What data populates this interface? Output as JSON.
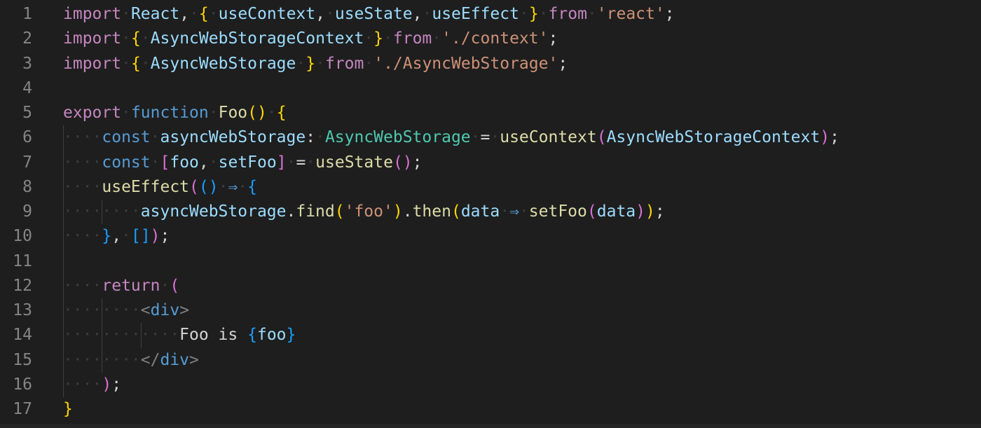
{
  "editor": {
    "language": "typescriptreact",
    "theme_bg": "#1e1e1e",
    "colors": {
      "keyword": "#c586c0",
      "storage": "#569cd6",
      "variable": "#9cdcfe",
      "function": "#dcdcaa",
      "string": "#ce9178",
      "type": "#4ec9b0",
      "bracket_level1": "#ffd700",
      "bracket_level2": "#da70d6",
      "bracket_level3": "#179fff",
      "line_number": "#858585"
    },
    "lines": [
      {
        "n": "1",
        "indent": 0,
        "tokens": [
          {
            "t": "import",
            "c": "kw"
          },
          {
            "t": " ",
            "c": "ws"
          },
          {
            "t": "React",
            "c": "var"
          },
          {
            "t": ",",
            "c": "pun"
          },
          {
            "t": " ",
            "c": "ws"
          },
          {
            "t": "{",
            "c": "b1"
          },
          {
            "t": " ",
            "c": "ws"
          },
          {
            "t": "useContext",
            "c": "var"
          },
          {
            "t": ",",
            "c": "pun"
          },
          {
            "t": " ",
            "c": "ws"
          },
          {
            "t": "useState",
            "c": "var"
          },
          {
            "t": ",",
            "c": "pun"
          },
          {
            "t": " ",
            "c": "ws"
          },
          {
            "t": "useEffect",
            "c": "var"
          },
          {
            "t": " ",
            "c": "ws"
          },
          {
            "t": "}",
            "c": "b1"
          },
          {
            "t": " ",
            "c": "ws"
          },
          {
            "t": "from",
            "c": "kw"
          },
          {
            "t": " ",
            "c": "ws"
          },
          {
            "t": "'react'",
            "c": "str"
          },
          {
            "t": ";",
            "c": "pun"
          }
        ]
      },
      {
        "n": "2",
        "indent": 0,
        "tokens": [
          {
            "t": "import",
            "c": "kw"
          },
          {
            "t": " ",
            "c": "ws"
          },
          {
            "t": "{",
            "c": "b1"
          },
          {
            "t": " ",
            "c": "ws"
          },
          {
            "t": "AsyncWebStorageContext",
            "c": "var"
          },
          {
            "t": " ",
            "c": "ws"
          },
          {
            "t": "}",
            "c": "b1"
          },
          {
            "t": " ",
            "c": "ws"
          },
          {
            "t": "from",
            "c": "kw"
          },
          {
            "t": " ",
            "c": "ws"
          },
          {
            "t": "'./context'",
            "c": "str"
          },
          {
            "t": ";",
            "c": "pun"
          }
        ]
      },
      {
        "n": "3",
        "indent": 0,
        "tokens": [
          {
            "t": "import",
            "c": "kw"
          },
          {
            "t": " ",
            "c": "ws"
          },
          {
            "t": "{",
            "c": "b1"
          },
          {
            "t": " ",
            "c": "ws"
          },
          {
            "t": "AsyncWebStorage",
            "c": "var"
          },
          {
            "t": " ",
            "c": "ws"
          },
          {
            "t": "}",
            "c": "b1"
          },
          {
            "t": " ",
            "c": "ws"
          },
          {
            "t": "from",
            "c": "kw"
          },
          {
            "t": " ",
            "c": "ws"
          },
          {
            "t": "'./AsyncWebStorage'",
            "c": "str"
          },
          {
            "t": ";",
            "c": "pun"
          }
        ]
      },
      {
        "n": "4",
        "indent": 0,
        "tokens": []
      },
      {
        "n": "5",
        "indent": 0,
        "tokens": [
          {
            "t": "export",
            "c": "kw"
          },
          {
            "t": " ",
            "c": "ws"
          },
          {
            "t": "function",
            "c": "sk"
          },
          {
            "t": " ",
            "c": "ws"
          },
          {
            "t": "Foo",
            "c": "fn"
          },
          {
            "t": "()",
            "c": "b1"
          },
          {
            "t": " ",
            "c": "ws"
          },
          {
            "t": "{",
            "c": "b1"
          }
        ]
      },
      {
        "n": "6",
        "indent": 1,
        "tokens": [
          {
            "t": "const",
            "c": "sk"
          },
          {
            "t": " ",
            "c": "ws"
          },
          {
            "t": "asyncWebStorage",
            "c": "var"
          },
          {
            "t": ":",
            "c": "pun"
          },
          {
            "t": " ",
            "c": "ws"
          },
          {
            "t": "AsyncWebStorage",
            "c": "ty"
          },
          {
            "t": " ",
            "c": "ws"
          },
          {
            "t": "=",
            "c": "op"
          },
          {
            "t": " ",
            "c": "ws"
          },
          {
            "t": "useContext",
            "c": "fn"
          },
          {
            "t": "(",
            "c": "b2"
          },
          {
            "t": "AsyncWebStorageContext",
            "c": "var"
          },
          {
            "t": ")",
            "c": "b2"
          },
          {
            "t": ";",
            "c": "pun"
          }
        ]
      },
      {
        "n": "7",
        "indent": 1,
        "tokens": [
          {
            "t": "const",
            "c": "sk"
          },
          {
            "t": " ",
            "c": "ws"
          },
          {
            "t": "[",
            "c": "b2"
          },
          {
            "t": "foo",
            "c": "var"
          },
          {
            "t": ",",
            "c": "pun"
          },
          {
            "t": " ",
            "c": "ws"
          },
          {
            "t": "setFoo",
            "c": "var"
          },
          {
            "t": "]",
            "c": "b2"
          },
          {
            "t": " ",
            "c": "ws"
          },
          {
            "t": "=",
            "c": "op"
          },
          {
            "t": " ",
            "c": "ws"
          },
          {
            "t": "useState",
            "c": "fn"
          },
          {
            "t": "()",
            "c": "b2"
          },
          {
            "t": ";",
            "c": "pun"
          }
        ]
      },
      {
        "n": "8",
        "indent": 1,
        "tokens": [
          {
            "t": "useEffect",
            "c": "fn"
          },
          {
            "t": "(",
            "c": "b2"
          },
          {
            "t": "()",
            "c": "b3"
          },
          {
            "t": " ",
            "c": "ws"
          },
          {
            "t": "⇒",
            "c": "ar"
          },
          {
            "t": " ",
            "c": "ws"
          },
          {
            "t": "{",
            "c": "b3"
          }
        ]
      },
      {
        "n": "9",
        "indent": 2,
        "tokens": [
          {
            "t": "asyncWebStorage",
            "c": "var"
          },
          {
            "t": ".",
            "c": "pun"
          },
          {
            "t": "find",
            "c": "fn"
          },
          {
            "t": "(",
            "c": "b1"
          },
          {
            "t": "'foo'",
            "c": "str"
          },
          {
            "t": ")",
            "c": "b1"
          },
          {
            "t": ".",
            "c": "pun"
          },
          {
            "t": "then",
            "c": "fn"
          },
          {
            "t": "(",
            "c": "b1"
          },
          {
            "t": "data",
            "c": "var"
          },
          {
            "t": " ",
            "c": "ws"
          },
          {
            "t": "⇒",
            "c": "ar"
          },
          {
            "t": " ",
            "c": "ws"
          },
          {
            "t": "setFoo",
            "c": "fn"
          },
          {
            "t": "(",
            "c": "b2"
          },
          {
            "t": "data",
            "c": "var"
          },
          {
            "t": ")",
            "c": "b2"
          },
          {
            "t": ")",
            "c": "b1"
          },
          {
            "t": ";",
            "c": "pun"
          }
        ]
      },
      {
        "n": "10",
        "indent": 1,
        "tokens": [
          {
            "t": "}",
            "c": "b3"
          },
          {
            "t": ",",
            "c": "pun"
          },
          {
            "t": " ",
            "c": "ws"
          },
          {
            "t": "[]",
            "c": "b3"
          },
          {
            "t": ")",
            "c": "b2"
          },
          {
            "t": ";",
            "c": "pun"
          }
        ]
      },
      {
        "n": "11",
        "indent": 0,
        "tokens": []
      },
      {
        "n": "12",
        "indent": 1,
        "tokens": [
          {
            "t": "return",
            "c": "kw"
          },
          {
            "t": " ",
            "c": "ws"
          },
          {
            "t": "(",
            "c": "b2"
          }
        ]
      },
      {
        "n": "13",
        "indent": 2,
        "tokens": [
          {
            "t": "<",
            "c": "tagp"
          },
          {
            "t": "div",
            "c": "tag"
          },
          {
            "t": ">",
            "c": "tagp"
          }
        ]
      },
      {
        "n": "14",
        "indent": 3,
        "tokens": [
          {
            "t": "Foo is ",
            "c": "txt"
          },
          {
            "t": "{",
            "c": "b3"
          },
          {
            "t": "foo",
            "c": "var"
          },
          {
            "t": "}",
            "c": "b3"
          }
        ]
      },
      {
        "n": "15",
        "indent": 2,
        "tokens": [
          {
            "t": "</",
            "c": "tagp"
          },
          {
            "t": "div",
            "c": "tag"
          },
          {
            "t": ">",
            "c": "tagp"
          }
        ]
      },
      {
        "n": "16",
        "indent": 1,
        "tokens": [
          {
            "t": ")",
            "c": "b2"
          },
          {
            "t": ";",
            "c": "pun"
          }
        ]
      },
      {
        "n": "17",
        "indent": 0,
        "tokens": [
          {
            "t": "}",
            "c": "b1"
          }
        ]
      }
    ]
  }
}
